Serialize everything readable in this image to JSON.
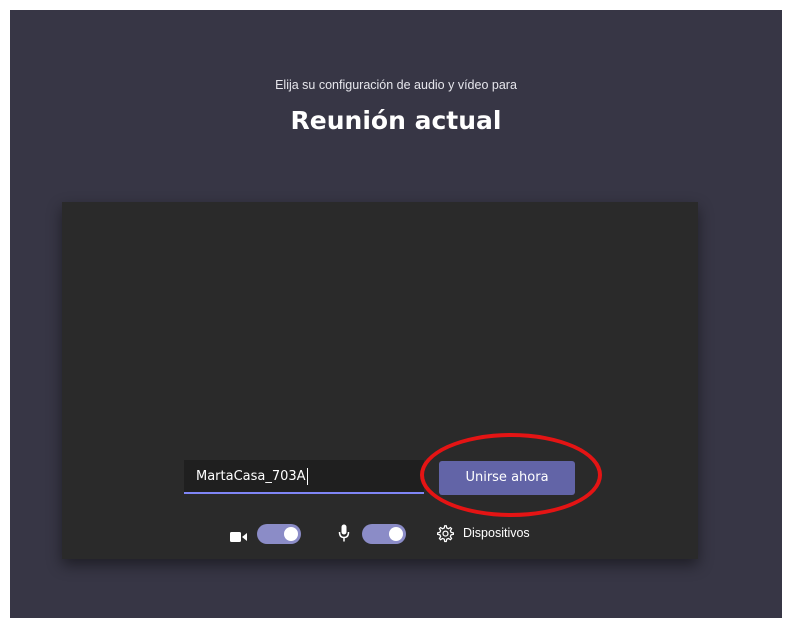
{
  "header": {
    "subtitle": "Elija su configuración de audio y vídeo para",
    "title": "Reunión actual"
  },
  "join_form": {
    "name_value": "MartaCasa_703A",
    "join_button_label": "Unirse ahora"
  },
  "controls": {
    "camera_icon": "video-camera-icon",
    "camera_on": true,
    "mic_icon": "microphone-icon",
    "mic_on": true,
    "devices_icon": "gear-icon",
    "devices_label": "Dispositivos"
  },
  "colors": {
    "background": "#373645",
    "preview": "#2a2a2a",
    "accent": "#6264a7",
    "toggle_on": "#8b8cc7",
    "highlight": "#e41414"
  }
}
